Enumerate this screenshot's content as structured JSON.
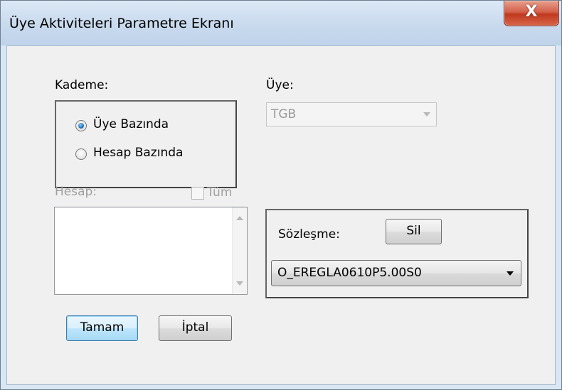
{
  "window": {
    "title": "Üye Aktiviteleri Parametre Ekranı",
    "close_glyph": "X"
  },
  "kademe": {
    "label": "Kademe:",
    "options": [
      {
        "label": "Üye Bazında",
        "checked": true
      },
      {
        "label": "Hesap Bazında",
        "checked": false
      }
    ]
  },
  "uye": {
    "label": "Üye:",
    "value": "TGB",
    "enabled": false
  },
  "hesap": {
    "label": "Hesap:",
    "enabled": false,
    "tum_label": "Tüm",
    "tum_checked": false,
    "items": []
  },
  "sozlesme": {
    "label": "Sözleşme:",
    "sil_label": "Sil",
    "value": "O_EREGLA0610P5.00S0"
  },
  "buttons": {
    "ok_label": "Tamam",
    "cancel_label": "İptal"
  },
  "colors": {
    "title_bg": "#c9daee",
    "client_bg": "#f0f0f0",
    "close_red": "#c0391f",
    "default_button": "#3c7fb1"
  }
}
